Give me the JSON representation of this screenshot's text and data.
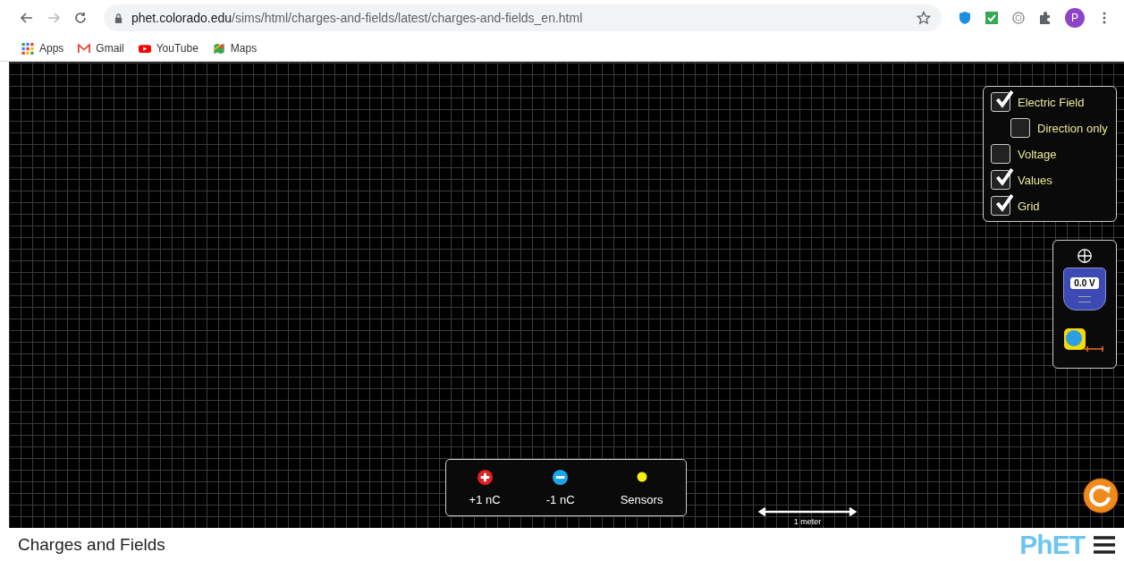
{
  "browser": {
    "url_host": "phet.colorado.edu",
    "url_path": "/sims/html/charges-and-fields/latest/charges-and-fields_en.html",
    "profile_initial": "P",
    "bookmarks": [
      {
        "kind": "apps",
        "label": "Apps"
      },
      {
        "kind": "gmail",
        "label": "Gmail"
      },
      {
        "kind": "youtube",
        "label": "YouTube"
      },
      {
        "kind": "maps",
        "label": "Maps"
      }
    ]
  },
  "controls": [
    {
      "label": "Electric Field",
      "checked": true,
      "children": [
        {
          "label": "Direction only",
          "checked": false
        }
      ]
    },
    {
      "label": "Voltage",
      "checked": false
    },
    {
      "label": "Values",
      "checked": true
    },
    {
      "label": "Grid",
      "checked": true
    }
  ],
  "voltmeter": {
    "reading": "0.0 V"
  },
  "toolbox": [
    {
      "kind": "positive",
      "label": "+1 nC"
    },
    {
      "kind": "negative",
      "label": "-1 nC"
    },
    {
      "kind": "sensor",
      "label": "Sensors"
    }
  ],
  "scale": {
    "label": "1 meter"
  },
  "footer": {
    "title": "Charges and Fields",
    "logo": "PhET"
  }
}
